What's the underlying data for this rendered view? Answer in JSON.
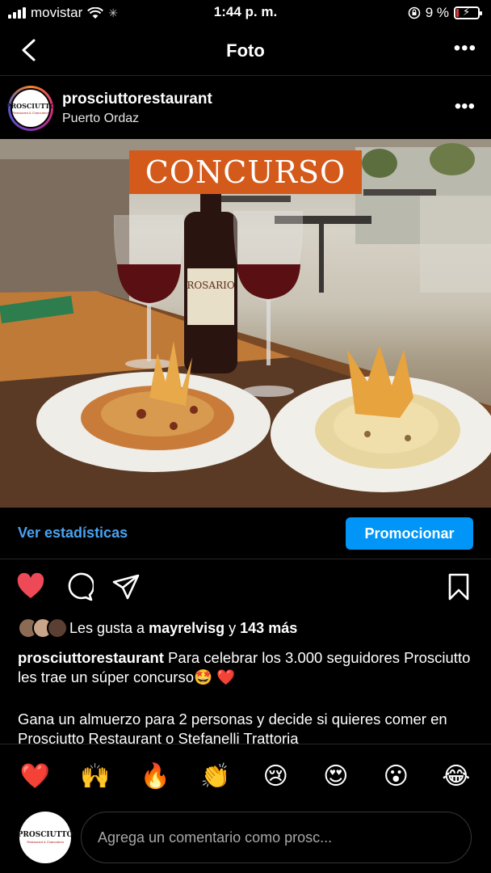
{
  "status": {
    "carrier": "movistar",
    "time": "1:44 p. m.",
    "battery": "9 %",
    "battery_level": 0.09
  },
  "nav": {
    "title": "Foto"
  },
  "post": {
    "username": "prosciuttorestaurant",
    "location": "Puerto Ordaz",
    "logo_text": "PROSCIUTTO",
    "logo_sub": "Restaurant & Charcutería",
    "image_banner": "CONCURSO",
    "bottle_label": "ROSARIO"
  },
  "stats": {
    "link_label": "Ver estadísticas",
    "promote_label": "Promocionar"
  },
  "likes": {
    "prefix": "Les gusta a ",
    "user": "mayrelvisg",
    "joiner": " y ",
    "count": "143 más"
  },
  "caption": {
    "username": "prosciuttorestaurant",
    "text": " Para celebrar los 3.000 seguidores Prosciutto les trae un súper concurso🤩 ❤️",
    "text2": "Gana un almuerzo para 2 personas y decide si quieres comer en Prosciutto Restaurant o Stefanelli Trattoria"
  },
  "emojis": [
    "❤️",
    "🙌",
    "🔥",
    "👏",
    "😢",
    "😍",
    "😮",
    "😂"
  ],
  "comment": {
    "placeholder": "Agrega un comentario como prosc..."
  },
  "colors": {
    "accent": "#0095f6",
    "link": "#4aa3f0",
    "like": "#ed4956",
    "banner": "#d35a1b"
  }
}
